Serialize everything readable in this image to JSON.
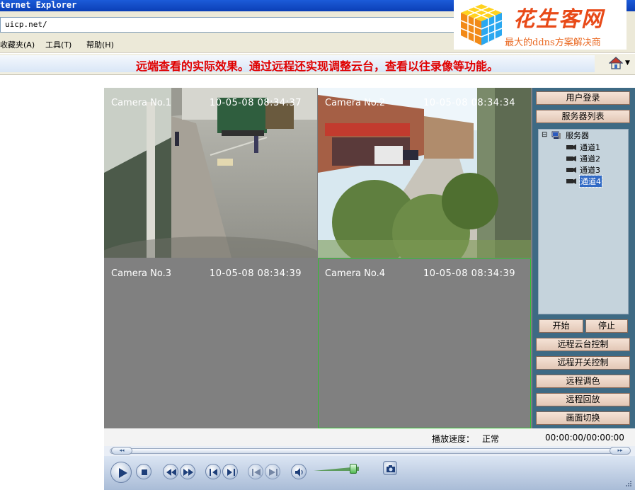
{
  "browser": {
    "title": "ternet Explorer",
    "address": "uicp.net/",
    "menu": [
      "收藏夹(A)",
      "工具(T)",
      "帮助(H)"
    ],
    "banner_message": "远端查看的实际效果。通过远程还实现调整云台，查看以往录像等功能。"
  },
  "logo": {
    "brand": "花生客网",
    "slogan": "最大的ddns方案解决商"
  },
  "cameras": [
    {
      "label": "Camera No.1",
      "time": "10-05-08  08:34:37",
      "has_video": true
    },
    {
      "label": "Camera No.2",
      "time": "10-05-08  08:34:34",
      "has_video": true
    },
    {
      "label": "Camera No.3",
      "time": "10-05-08  08:34:39",
      "has_video": false
    },
    {
      "label": "Camera No.4",
      "time": "10-05-08  08:34:39",
      "has_video": false,
      "selected": true
    }
  ],
  "panel": {
    "login": "用户登录",
    "server_list": "服务器列表",
    "tree_root": "服务器",
    "tree_channels": [
      "通道1",
      "通道2",
      "通道3",
      "通道4"
    ],
    "tree_selected": "通道4",
    "start": "开始",
    "stop": "停止",
    "actions": [
      "远程云台控制",
      "远程开关控制",
      "远程调色",
      "远程回放",
      "画面切换"
    ]
  },
  "status": {
    "speed_label": "播放速度：",
    "speed_value": "正常",
    "time": "00:00:00/00:00:00"
  },
  "colors": {
    "panel_bg": "#3e6a84",
    "button_bg": "#ecd3c4",
    "selection_border": "#2fc22f",
    "banner_text": "#e00000"
  }
}
